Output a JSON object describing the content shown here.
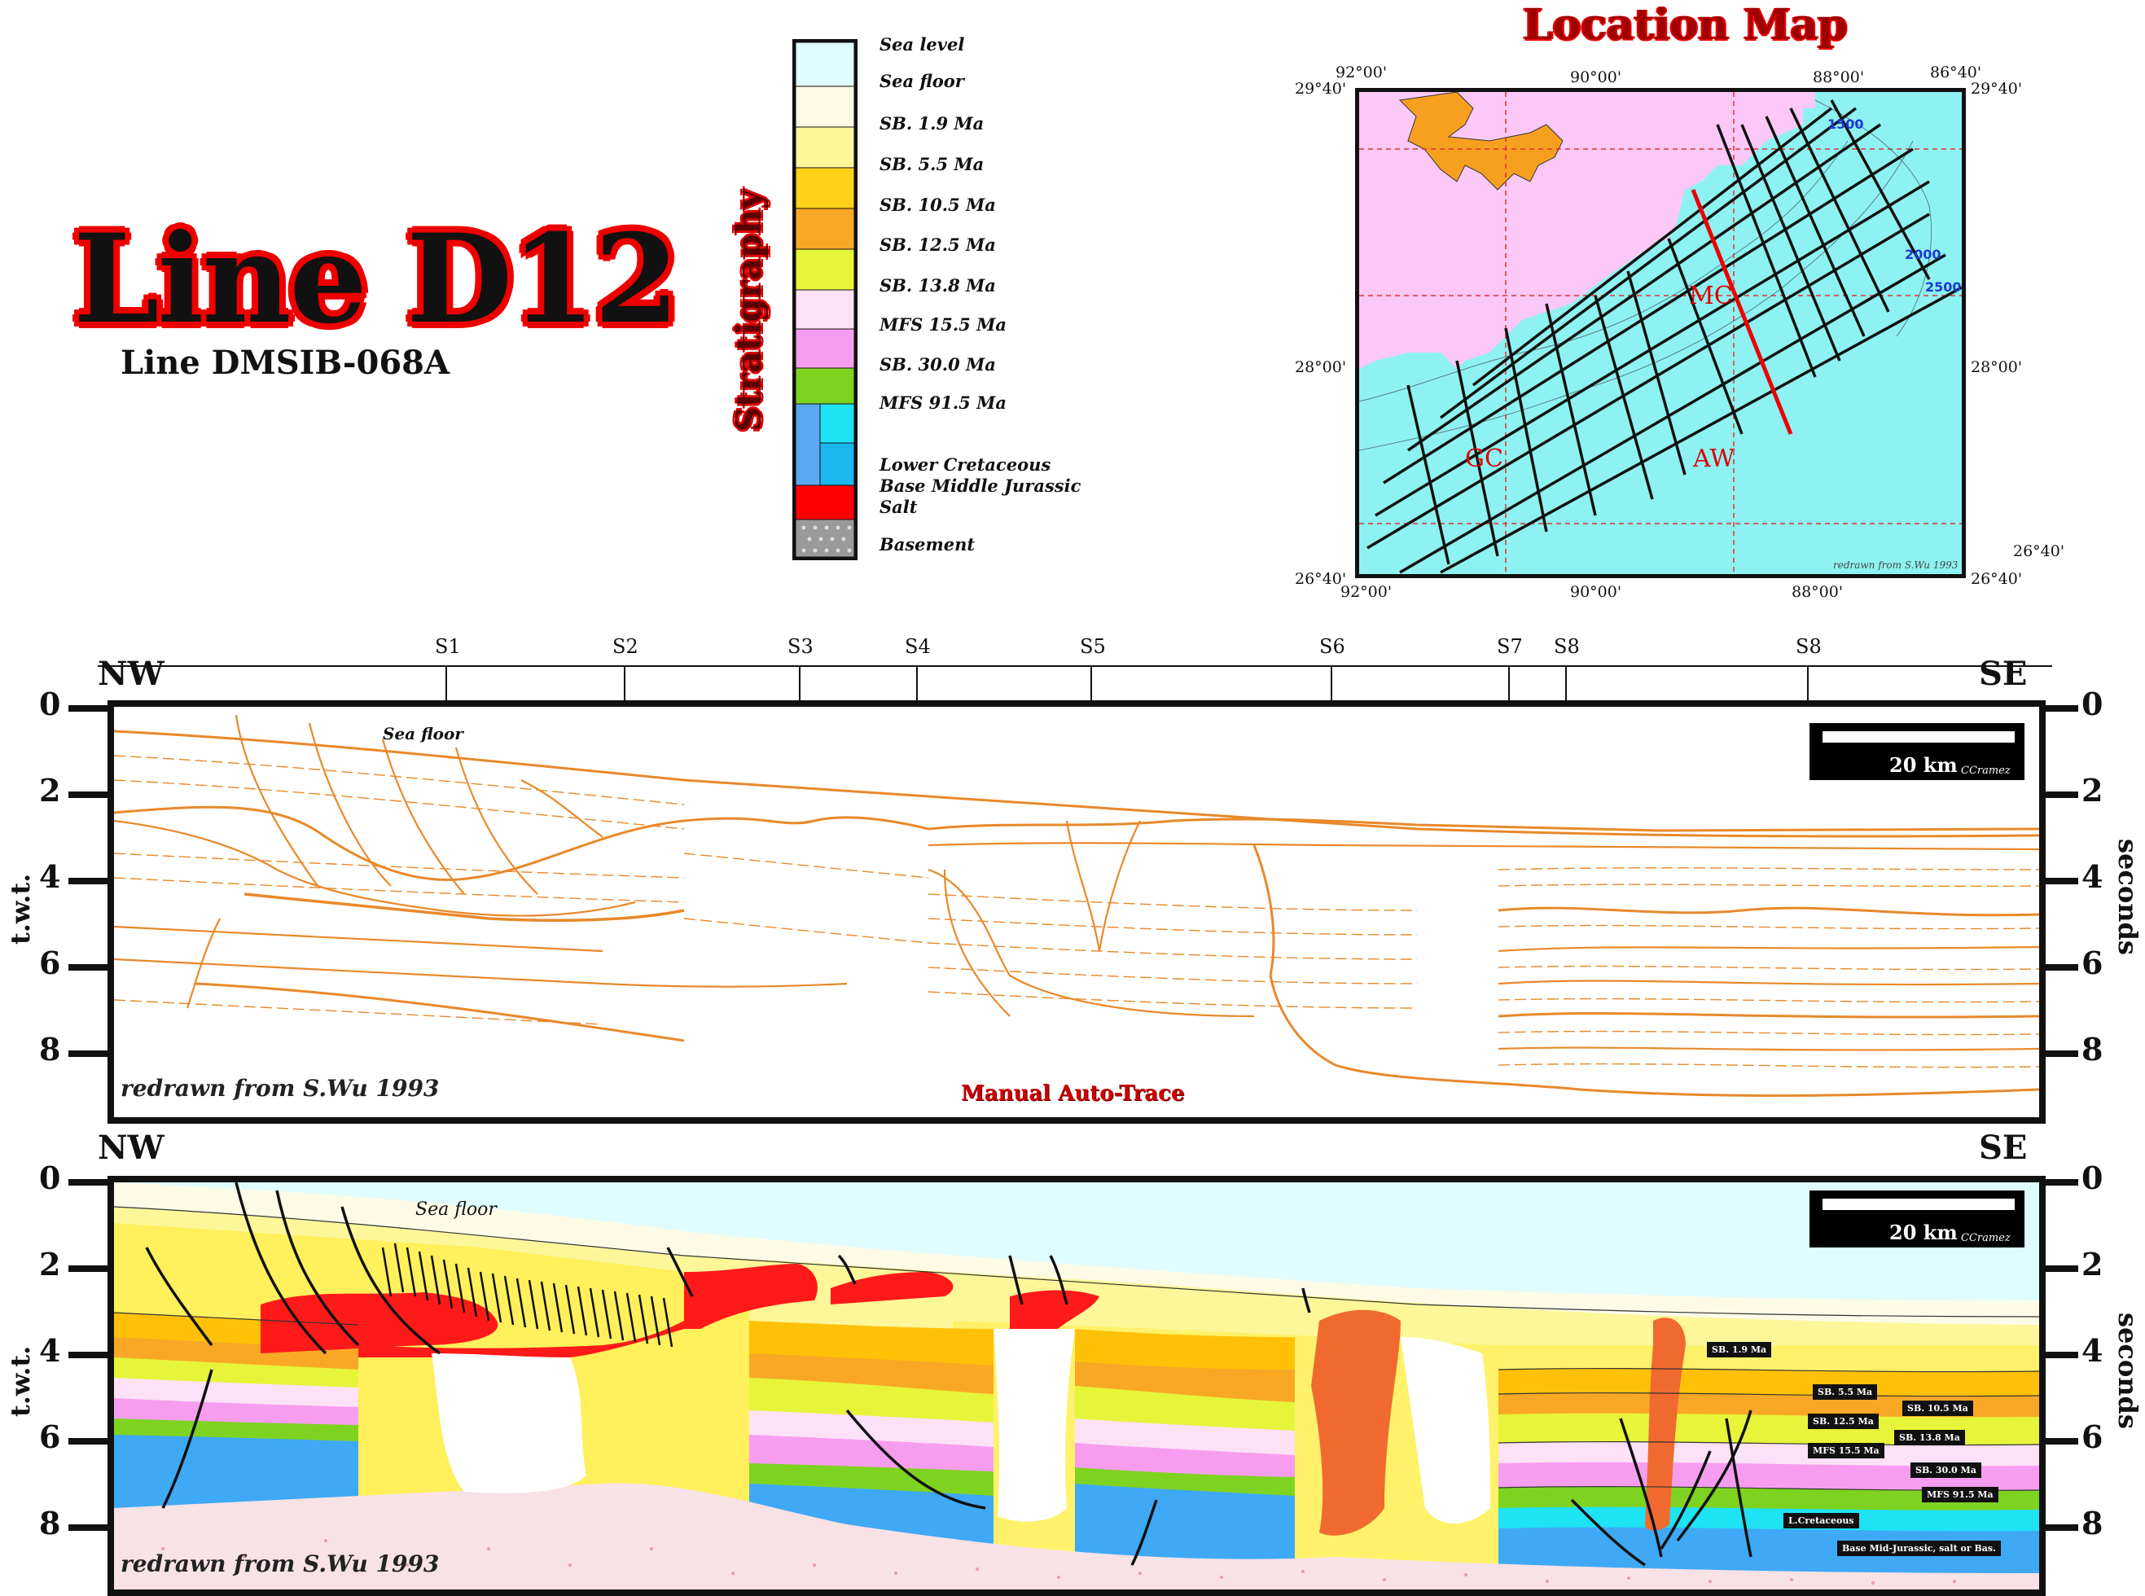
{
  "header": {
    "title": "Line D12",
    "subtitle": "Line DMSIB-068A",
    "stratigraphy_label": "Stratigraphy"
  },
  "legend": {
    "items": [
      {
        "label": "Sea level",
        "color": "#dffcff"
      },
      {
        "label": "Sea floor",
        "color": "#fdfbe6"
      },
      {
        "label": "SB. 1.9 Ma",
        "color": "#fdf79a"
      },
      {
        "label": "SB. 5.5 Ma",
        "color": "#fff05c"
      },
      {
        "label": "SB. 10.5 Ma",
        "color": "#ffc107"
      },
      {
        "label": "SB. 12.5 Ma",
        "color": "#f9a825"
      },
      {
        "label": "SB. 13.8 Ma",
        "color": "#e6f53a"
      },
      {
        "label": "MFS 15.5 Ma",
        "color": "#fde1f7"
      },
      {
        "label": "SB. 30.0 Ma",
        "color": "#f79df0"
      },
      {
        "label": "MFS 91.5 Ma",
        "color": "#7ed321"
      },
      {
        "label": "Lower Cretaceous",
        "color": "#3fa9f5"
      },
      {
        "label": "Base Middle Jurassic",
        "color": "#1ab8ef"
      },
      {
        "label": "Salt",
        "color": "#ff0000"
      },
      {
        "label": "Basement",
        "color": "#9a9a9a"
      }
    ]
  },
  "location_map": {
    "title": "Location Map",
    "coords": {
      "tl": "29°40'",
      "tr": "29°40'",
      "ml": "28°00'",
      "mr": "28°00'",
      "bl": "26°40'",
      "br": "26°40'",
      "br2": "26°40'",
      "top_lon": [
        "92°00'",
        "90°00'",
        "88°00'",
        "86°40'"
      ],
      "bottom_lon": [
        "92°00'",
        "90°00'",
        "88°00'"
      ]
    },
    "area_labels": [
      "MC",
      "GC",
      "AW"
    ],
    "credit": "redrawn from S.Wu 1993",
    "contours": [
      "1500",
      "2000",
      "2500"
    ]
  },
  "section": {
    "stations": [
      "S1",
      "S2",
      "S3",
      "S4",
      "S5",
      "S6",
      "S7",
      "S8",
      "S8"
    ],
    "left_dir": "NW",
    "right_dir": "SE",
    "ticks": [
      "0",
      "2",
      "4",
      "6",
      "8"
    ],
    "left_axis": "t.w.t.",
    "right_axis": "seconds",
    "scale": "20 km",
    "scale_credit": "CCramez",
    "sea_floor": "Sea floor",
    "credit": "redrawn from S.Wu 1993",
    "top_label": "Manual Auto-Trace",
    "unit_tags": [
      "SB. 1.9 Ma",
      "SB. 5.5 Ma",
      "SB. 10.5 Ma",
      "SB. 12.5 Ma",
      "SB. 13.8 Ma",
      "MFS 15.5 Ma",
      "SB. 30.0 Ma",
      "MFS 91.5 Ma",
      "L.Cretaceous",
      "Base Mid-Jurassic, salt or Bas."
    ]
  },
  "colors": {
    "trace": "#e8892a",
    "salt": "#ff1a1a",
    "salt_orange": "#f06a30",
    "sea": "#dffcff",
    "basement": "#f8e6e6"
  }
}
